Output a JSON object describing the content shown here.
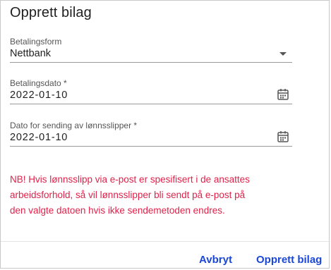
{
  "dialog": {
    "title": "Opprett bilag",
    "fields": [
      {
        "label": "Betalingsform",
        "value": "Nettbank",
        "icon": "chevron-down-icon"
      },
      {
        "label": "Betalingsdato *",
        "value": "2022-01-10",
        "icon": "calendar-icon"
      },
      {
        "label": "Dato for sending av lønnsslipper *",
        "value": "2022-01-10",
        "icon": "calendar-icon"
      }
    ],
    "warning": "NB! Hvis lønnsslipp via e-post er spesifisert i de ansattes arbeidsforhold, så vil lønnsslipper bli sendt på e-post på den valgte datoen hvis ikke sendemetoden endres.",
    "buttons": {
      "cancel": "Avbryt",
      "confirm": "Opprett bilag"
    }
  },
  "colors": {
    "warning": "#e0224a",
    "accent": "#1a47d8"
  }
}
